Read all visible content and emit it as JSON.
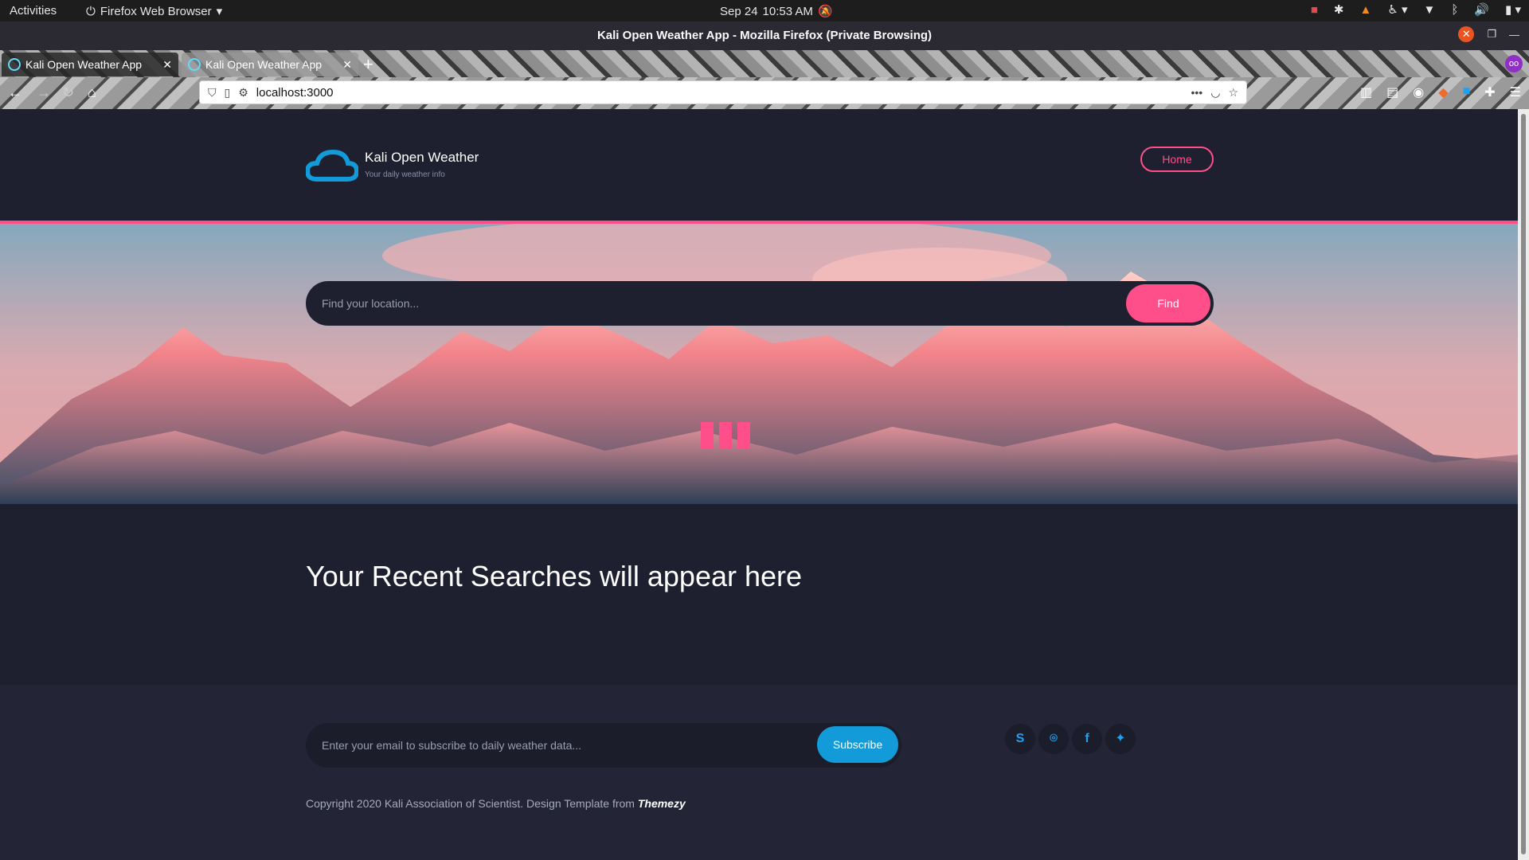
{
  "system_bar": {
    "activities": "Activities",
    "app_name": "Firefox Web Browser",
    "date": "Sep 24",
    "time": "10:53 AM"
  },
  "window": {
    "title": "Kali Open Weather App - Mozilla Firefox (Private Browsing)"
  },
  "tabs": [
    {
      "label": "Kali Open Weather App"
    },
    {
      "label": "Kali Open Weather App"
    }
  ],
  "address_bar": {
    "url": "localhost:3000"
  },
  "site": {
    "brand_title": "Kali Open Weather",
    "brand_subtitle": "Your daily weather info",
    "nav_home": "Home",
    "search_placeholder": "Find your location...",
    "find_button": "Find",
    "recent_heading": "Your Recent Searches will appear here",
    "email_placeholder": "Enter your email to subscribe to daily weather data...",
    "subscribe_button": "Subscribe",
    "copyright_text": "Copyright 2020 Kali Association of Scientist. Design Template from ",
    "copyright_brand": "Themezy",
    "socials": [
      "skype-icon",
      "github-icon",
      "facebook-icon",
      "twitter-icon"
    ]
  },
  "colors": {
    "accent_pink": "#ff4f8b",
    "accent_blue": "#129bd8",
    "background": "#1e2030"
  }
}
